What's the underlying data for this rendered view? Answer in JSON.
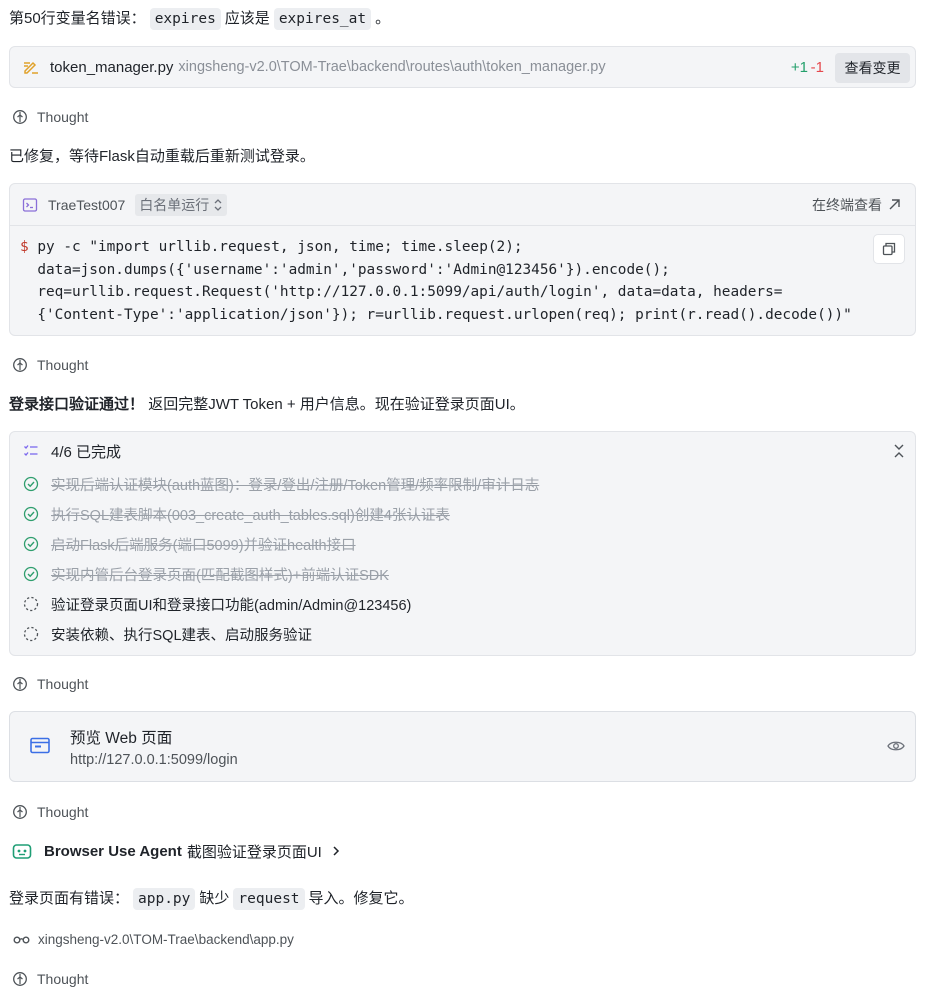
{
  "messages": {
    "line_error": {
      "prefix": "第50行变量名错误：",
      "old_var": "expires",
      "mid": "应该是",
      "new_var": "expires_at",
      "suffix": "。"
    },
    "fixed": "已修复，等待Flask自动重载后重新测试登录。",
    "verified": {
      "bold": "登录接口验证通过！",
      "rest": "返回完整JWT Token + 用户信息。现在验证登录页面UI。"
    },
    "page_error": {
      "prefix": "登录页面有错误：",
      "file": "app.py",
      "mid": "缺少",
      "symbol": "request",
      "suffix": "导入。修复它。"
    }
  },
  "thought_label": "Thought",
  "file_change": {
    "filename": "token_manager.py",
    "path": "xingsheng-v2.0\\TOM-Trae\\backend\\routes\\auth\\token_manager.py",
    "additions": "+1",
    "deletions": "-1",
    "view_button": "查看变更"
  },
  "terminal": {
    "name": "TraeTest007",
    "mode": "白名单运行",
    "open_label": "在终端查看",
    "prompt": "$",
    "lines": [
      "py -c \"import urllib.request, json, time; time.sleep(2);",
      "data=json.dumps({'username':'admin','password':'Admin@123456'}).encode();",
      "req=urllib.request.Request('http://127.0.0.1:5099/api/auth/login', data=data, headers=",
      "{'Content-Type':'application/json'}); r=urllib.request.urlopen(req); print(r.read().decode())\""
    ]
  },
  "todo": {
    "progress": "4/6 已完成",
    "items": [
      {
        "text": "实现后端认证模块(auth蓝图)：登录/登出/注册/Token管理/频率限制/审计日志",
        "status": "done"
      },
      {
        "text": "执行SQL建表脚本(003_create_auth_tables.sql)创建4张认证表",
        "status": "done"
      },
      {
        "text": "启动Flask后端服务(端口5099)并验证health接口",
        "status": "done"
      },
      {
        "text": "实现内管后台登录页面(匹配截图样式)+前端认证SDK",
        "status": "done"
      },
      {
        "text": "验证登录页面UI和登录接口功能(admin/Admin@123456)",
        "status": "pending"
      },
      {
        "text": "安装依赖、执行SQL建表、启动服务验证",
        "status": "pending"
      }
    ]
  },
  "preview": {
    "title": "预览 Web 页面",
    "url": "http://127.0.0.1:5099/login"
  },
  "agent": {
    "name": "Browser Use Agent",
    "desc": "截图验证登录页面UI"
  },
  "read_file": {
    "path": "xingsheng-v2.0\\TOM-Trae\\backend\\app.py"
  },
  "colors": {
    "accent_green": "#23a06b",
    "accent_red": "#e5484d",
    "check_green": "#2f9e6e",
    "agent_green": "#1f9e75",
    "preview_blue": "#3b6fe6",
    "todo_purple": "#7b68ee"
  }
}
